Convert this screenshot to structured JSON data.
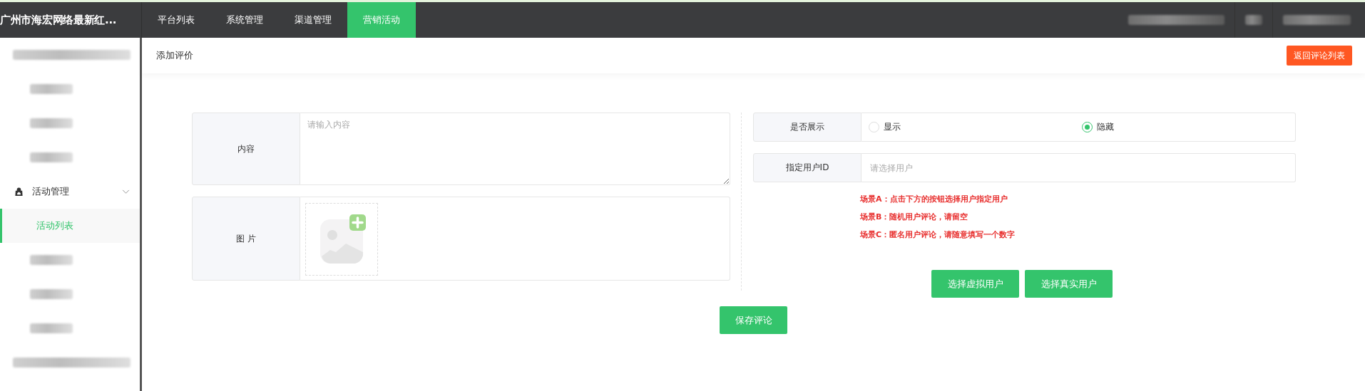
{
  "topbar": {
    "brand": "广州市海宏网络最新红...",
    "nav": [
      {
        "label": "平台列表",
        "selected": false
      },
      {
        "label": "系统管理",
        "selected": false
      },
      {
        "label": "渠道管理",
        "selected": false
      },
      {
        "label": "营销活动",
        "selected": true
      }
    ]
  },
  "sidebar": {
    "group": {
      "label": "活动管理",
      "expanded": true
    },
    "items": [
      {
        "label": "活动列表",
        "selected": true
      }
    ]
  },
  "header": {
    "title": "添加评价",
    "back_button": "返回评论列表"
  },
  "left_form": {
    "content": {
      "label": "内容",
      "placeholder": "请输入内容"
    },
    "picture": {
      "label": "图 片"
    }
  },
  "right_form": {
    "display": {
      "label": "是否展示",
      "options": [
        {
          "label": "显示",
          "selected": false
        },
        {
          "label": "隐藏",
          "selected": true
        }
      ]
    },
    "user": {
      "label": "指定用户ID",
      "placeholder": "请选择用户"
    },
    "hints": [
      "场景A：点击下方的按钮选择用户指定用户",
      "场景B：随机用户评论，请留空",
      "场景C：匿名用户评论，请随意填写一个数字"
    ],
    "buttons": [
      "选择虚拟用户",
      "选择真实用户"
    ]
  },
  "save_button": "保存评论"
}
